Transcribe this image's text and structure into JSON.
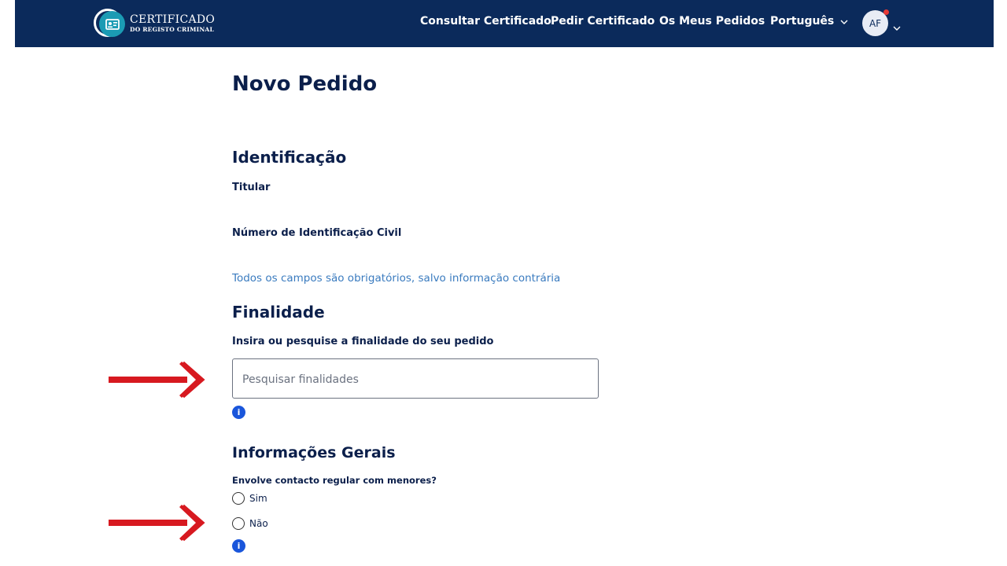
{
  "header": {
    "logo": {
      "line1": "CERTIFICADO",
      "line2": "DO REGISTO CRIMINAL"
    },
    "nav": {
      "consultar": "Consultar Certificado",
      "pedir": "Pedir Certificado",
      "pedidos": "Os Meus Pedidos"
    },
    "language": "Português",
    "avatar_initials": "AF"
  },
  "page": {
    "title": "Novo Pedido",
    "identificacao": {
      "heading": "Identificação",
      "titular_label": "Titular",
      "nic_label": "Número de Identificação Civil"
    },
    "required_note": "Todos os campos são obrigatórios, salvo informação contrária",
    "finalidade": {
      "heading": "Finalidade",
      "label": "Insira ou pesquise a finalidade do seu pedido",
      "placeholder": "Pesquisar finalidades",
      "value": ""
    },
    "informacoes": {
      "heading": "Informações Gerais",
      "question": "Envolve contacto regular com menores?",
      "options": [
        "Sim",
        "Não"
      ]
    },
    "info_icon_glyph": "i"
  },
  "colors": {
    "header_bg": "#0b2a5b",
    "accent_teal": "#1b9bb4",
    "link_blue": "#3a7bbf",
    "info_blue": "#1a56db",
    "arrow_red": "#d71920"
  }
}
